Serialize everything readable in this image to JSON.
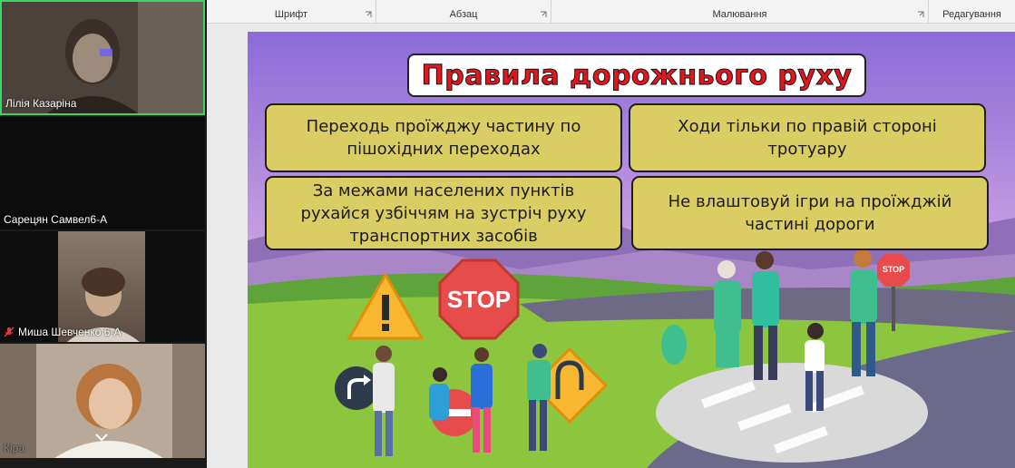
{
  "participants": [
    {
      "name": "Лілія Казаріна",
      "active_speaker": true,
      "muted": false
    },
    {
      "name": "Сарецян Самвел6-А",
      "active_speaker": false,
      "muted": false
    },
    {
      "name": "Миша Шевченко 6-А",
      "active_speaker": false,
      "muted": true
    },
    {
      "name": "Кіра",
      "active_speaker": false,
      "muted": false
    }
  ],
  "ribbon": {
    "groups": [
      "Шрифт",
      "Абзац",
      "Малювання",
      "Редагування"
    ]
  },
  "slide": {
    "title": "Правила дорожнього руху",
    "rules": [
      "Переходь проїжджу частину по пішохідних переходах",
      "Ходи тільки по правій стороні тротуару",
      "За межами населених пунктів рухайся узбіччям на зустріч руху транспортних засобів",
      "Не влаштовуй ігри на проїжджій частині дороги"
    ],
    "stop_sign_text": "STOP",
    "small_sign_text": "STOP"
  },
  "colors": {
    "accent_green": "#3ad66a",
    "rule_box": "#d9cd63",
    "title_red": "#e4151d"
  }
}
